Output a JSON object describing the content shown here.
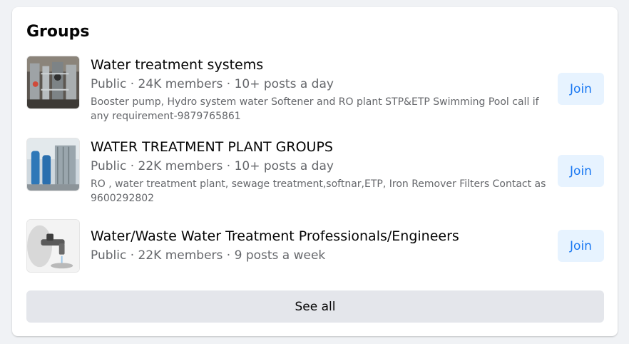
{
  "section": {
    "title": "Groups",
    "see_all_label": "See all"
  },
  "groups": [
    {
      "name": "Water treatment systems",
      "meta": "Public · 24K members · 10+ posts a day",
      "description": "Booster pump, Hydro system water Softener and RO plant STP&ETP Swimming Pool call if any requirement-9879765861",
      "join_label": "Join"
    },
    {
      "name": "WATER TREATMENT PLANT GROUPS",
      "meta": "Public · 22K members · 10+ posts a day",
      "description": "RO , water treatment plant, sewage treatment,softnar,ETP, Iron Remover Filters Contact as 9600292802",
      "join_label": "Join"
    },
    {
      "name": "Water/Waste Water Treatment Professionals/Engineers",
      "meta": "Public · 22K members · 9 posts a week",
      "description": "",
      "join_label": "Join"
    }
  ],
  "colors": {
    "accent": "#1877f2",
    "join_bg": "#e7f3ff",
    "see_all_bg": "#e4e6eb",
    "secondary_text": "#65676b"
  }
}
